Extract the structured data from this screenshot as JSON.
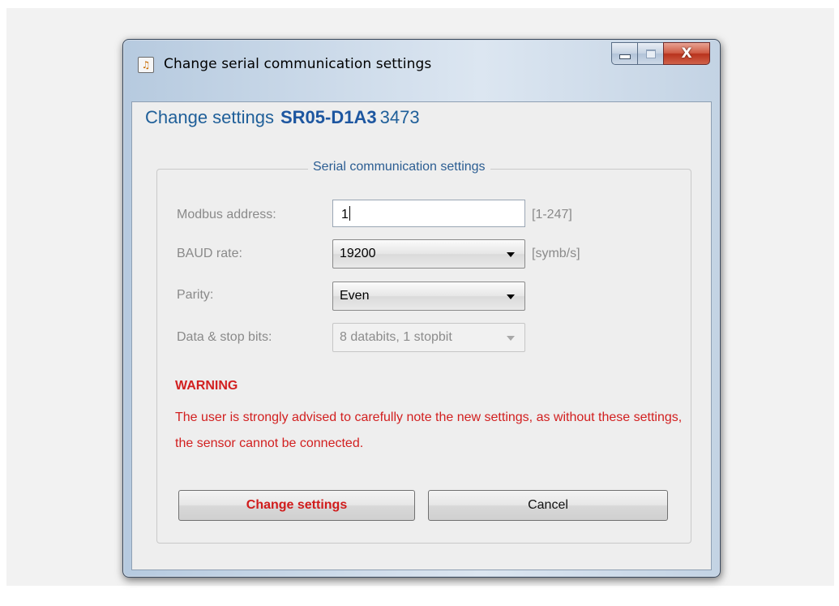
{
  "window": {
    "title": "Change serial communication settings",
    "icon": "java-app-icon",
    "controls": {
      "close_glyph": "X"
    }
  },
  "heading": {
    "prefix": "Change settings",
    "model": "SR05-D1A3",
    "serial": "3473"
  },
  "group": {
    "title": "Serial communication settings",
    "fields": {
      "modbus": {
        "label": "Modbus address:",
        "value": "1",
        "unit": "[1-247]"
      },
      "baud": {
        "label": "BAUD rate:",
        "value": "19200",
        "unit": "[symb/s]"
      },
      "parity": {
        "label": "Parity:",
        "value": "Even"
      },
      "databits": {
        "label": "Data & stop bits:",
        "value": "8 databits, 1 stopbit"
      }
    },
    "warning": {
      "title": "WARNING",
      "text": "The user is strongly advised to carefully note the new settings, as without these settings, the sensor cannot be connected."
    },
    "buttons": {
      "change": "Change settings",
      "cancel": "Cancel"
    }
  },
  "colors": {
    "accent": "#1f5f99",
    "warning": "#d22020"
  }
}
